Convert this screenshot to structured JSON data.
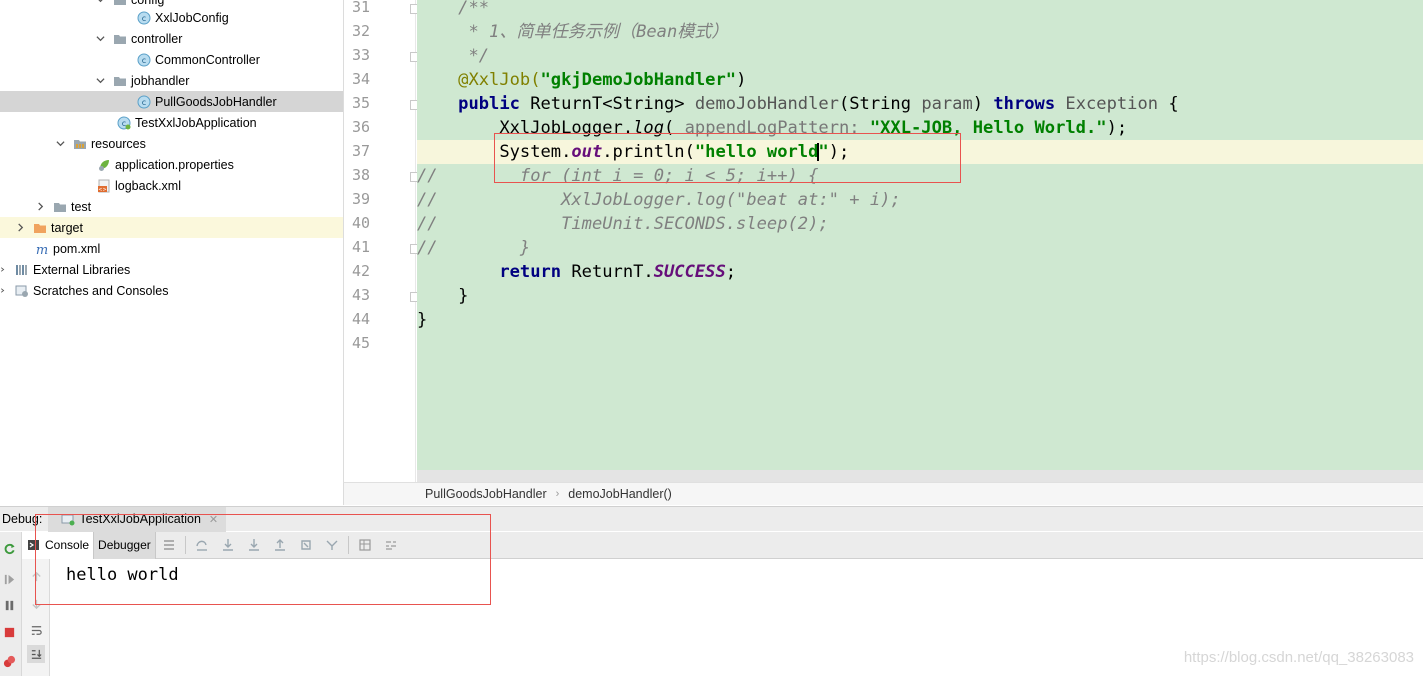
{
  "project_tree": {
    "items": [
      {
        "label": "config",
        "icon": "folder-icon",
        "expanded": true
      },
      {
        "label": "XxlJobConfig",
        "icon": "class-icon"
      },
      {
        "label": "controller",
        "icon": "folder-icon",
        "expanded": true
      },
      {
        "label": "CommonController",
        "icon": "class-icon"
      },
      {
        "label": "jobhandler",
        "icon": "folder-icon",
        "expanded": true
      },
      {
        "label": "PullGoodsJobHandler",
        "icon": "class-icon",
        "selected": true
      },
      {
        "label": "TestXxlJobApplication",
        "icon": "spring-class-icon"
      },
      {
        "label": "resources",
        "icon": "resources-folder-icon",
        "expanded": true
      },
      {
        "label": "application.properties",
        "icon": "properties-file-icon"
      },
      {
        "label": "logback.xml",
        "icon": "xml-file-icon"
      },
      {
        "label": "test",
        "icon": "folder-icon",
        "expanded": false
      },
      {
        "label": "target",
        "icon": "orange-folder-icon",
        "expanded": false
      },
      {
        "label": "pom.xml",
        "icon": "maven-icon"
      },
      {
        "label": "External Libraries",
        "icon": "libraries-icon",
        "expanded": false
      },
      {
        "label": "Scratches and Consoles",
        "icon": "scratches-icon",
        "expanded": false
      }
    ]
  },
  "editor": {
    "line_numbers": [
      "31",
      "32",
      "33",
      "34",
      "35",
      "36",
      "37",
      "38",
      "39",
      "40",
      "41",
      "42",
      "43",
      "44",
      "45"
    ],
    "lines": {
      "l31": "    /**",
      "l32": "     * 1、简单任务示例（Bean模式）",
      "l33": "     */",
      "l34_ann": "@XxlJob(",
      "l34_str": "\"gkjDemoJobHandler\"",
      "l34_end": ")",
      "l35_kw1": "public",
      "l35_type": " ReturnT<String> ",
      "l35_method": "demoJobHandler",
      "l35_params": "(String ",
      "l35_param": "param",
      "l35_close": ") ",
      "l35_kw2": "throws",
      "l35_exc": " Exception",
      "l35_brace": " {",
      "l36_call": "XxlJobLogger.",
      "l36_method": "log",
      "l36_open": "( ",
      "l36_hint": "appendLogPattern:",
      "l36_str": " \"XXL-JOB, Hello World.\"",
      "l36_end": ");",
      "l37_a": "System.",
      "l37_field": "out",
      "l37_b": ".println(",
      "l37_str_a": "\"hello world",
      "l37_str_b": "\"",
      "l37_end": ");",
      "l38": "//        for (int i = 0; i < 5; i++) {",
      "l39": "//            XxlJobLogger.log(\"beat at:\" + i);",
      "l40": "//            TimeUnit.SECONDS.sleep(2);",
      "l41": "//        }",
      "l42_kw": "return",
      "l42_a": " ReturnT.",
      "l42_field": "SUCCESS",
      "l42_end": ";",
      "l43": "    }",
      "l44": "}"
    }
  },
  "breadcrumb": {
    "class_name": "PullGoodsJobHandler",
    "method_name": "demoJobHandler()"
  },
  "debug": {
    "label": "Debug:",
    "run_config": "TestXxlJobApplication",
    "tabs": {
      "console": "Console",
      "debugger": "Debugger"
    },
    "console_output": "hello world"
  },
  "watermark": "https://blog.csdn.net/qq_38263083",
  "colors": {
    "code_bg": "#cfe8d1",
    "current_line": "#f7f6dc",
    "keyword": "#000080",
    "string": "#008000",
    "annotation_box": "#e8534f"
  }
}
